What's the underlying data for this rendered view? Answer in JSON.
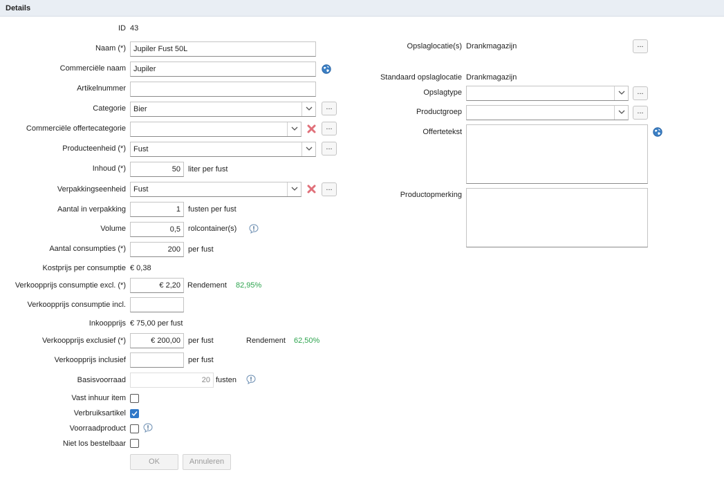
{
  "header": {
    "title": "Details"
  },
  "left": {
    "id_label": "ID",
    "id_value": "43",
    "naam_label": "Naam (*)",
    "naam_value": "Jupiler Fust 50L",
    "commerciele_naam_label": "Commerciële naam",
    "commerciele_naam_value": "Jupiler",
    "artikelnummer_label": "Artikelnummer",
    "artikelnummer_value": "",
    "categorie_label": "Categorie",
    "categorie_value": "Bier",
    "offertecategorie_label": "Commerciële offertecategorie",
    "offertecategorie_value": "",
    "producteenheid_label": "Producteenheid (*)",
    "producteenheid_value": "Fust",
    "inhoud_label": "Inhoud (*)",
    "inhoud_value": "50",
    "inhoud_unit": "liter  per fust",
    "verpakkingseenheid_label": "Verpakkingseenheid",
    "verpakkingseenheid_value": "Fust",
    "aantal_verpakking_label": "Aantal in verpakking",
    "aantal_verpakking_value": "1",
    "aantal_verpakking_unit": "fusten  per fust",
    "volume_label": "Volume",
    "volume_value": "0,5",
    "volume_unit": "rolcontainer(s)",
    "aantal_consumpties_label": "Aantal consumpties (*)",
    "aantal_consumpties_value": "200",
    "aantal_consumpties_unit": "per  fust",
    "kostprijs_label": "Kostprijs per consumptie",
    "kostprijs_value": "€ 0,38",
    "vk_consumptie_excl_label": "Verkoopprijs consumptie excl. (*)",
    "vk_consumptie_excl_value": "€ 2,20",
    "rendement_label": "Rendement",
    "rendement_consumptie": "82,95%",
    "vk_consumptie_incl_label": "Verkoopprijs consumptie incl.",
    "vk_consumptie_incl_value": "",
    "inkoopprijs_label": "Inkoopprijs",
    "inkoopprijs_value": "€ 75,00 per fust",
    "vk_exclusief_label": "Verkoopprijs exclusief (*)",
    "vk_exclusief_value": "€ 200,00",
    "vk_exclusief_unit": "per fust",
    "rendement_fust": "62,50%",
    "vk_inclusief_label": "Verkoopprijs inclusief",
    "vk_inclusief_value": "",
    "vk_inclusief_unit": "per fust",
    "basisvoorraad_label": "Basisvoorraad",
    "basisvoorraad_value": "20",
    "basisvoorraad_unit": "fusten",
    "vast_inhuur_label": "Vast inhuur item",
    "vast_inhuur_checked": false,
    "verbruiksartikel_label": "Verbruiksartikel",
    "verbruiksartikel_checked": true,
    "voorraadproduct_label": "Voorraadproduct",
    "voorraadproduct_checked": false,
    "niet_los_label": "Niet los bestelbaar",
    "niet_los_checked": false,
    "ok_label": "OK",
    "annuleren_label": "Annuleren",
    "more_label": "..."
  },
  "right": {
    "opslaglocaties_label": "Opslaglocatie(s)",
    "opslaglocaties_value": "Drankmagazijn",
    "standaard_label": "Standaard opslaglocatie",
    "standaard_value": "Drankmagazijn",
    "opslagtype_label": "Opslagtype",
    "opslagtype_value": "",
    "productgroep_label": "Productgroep",
    "productgroep_value": "",
    "offertetekst_label": "Offertetekst",
    "offertetekst_value": "",
    "productopmerking_label": "Productopmerking",
    "productopmerking_value": ""
  },
  "colors": {
    "accent": "#2f78c8",
    "green": "#2ea44f",
    "delete": "#e0707a"
  },
  "icons": [
    "globe-icon",
    "delete-x-icon",
    "info-icon",
    "chevron-down-icon",
    "check-icon"
  ]
}
